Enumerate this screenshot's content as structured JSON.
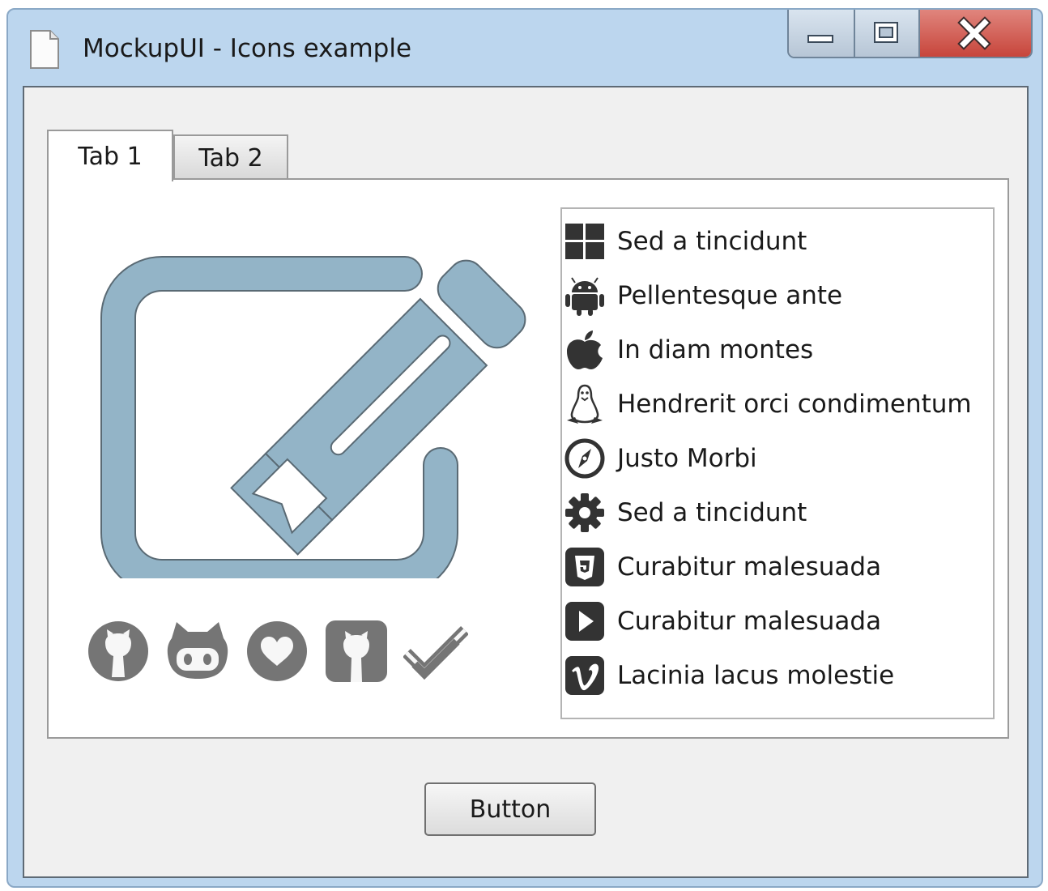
{
  "window": {
    "title": "MockupUI - Icons example",
    "title_bar_color": "#bcd6ee",
    "close_button_color": "#c7453b"
  },
  "tabs": [
    {
      "label": "Tab 1",
      "selected": true
    },
    {
      "label": "Tab 2",
      "selected": false
    }
  ],
  "main_icon": {
    "name": "edit-pencil-icon",
    "color": "#93b4c7"
  },
  "social_icons": [
    {
      "name": "github-icon"
    },
    {
      "name": "github-alt-icon"
    },
    {
      "name": "heart-circle-icon"
    },
    {
      "name": "github-square-icon"
    },
    {
      "name": "check-double-icon"
    }
  ],
  "social_icon_color": "#757575",
  "list": {
    "items": [
      {
        "icon": "windows-icon",
        "label": "Sed a tincidunt"
      },
      {
        "icon": "android-icon",
        "label": "Pellentesque ante"
      },
      {
        "icon": "apple-icon",
        "label": "In diam montes"
      },
      {
        "icon": "linux-icon",
        "label": "Hendrerit orci condimentum"
      },
      {
        "icon": "compass-icon",
        "label": "Justo Morbi"
      },
      {
        "icon": "gear-icon",
        "label": "Sed a tincidunt"
      },
      {
        "icon": "html5-icon",
        "label": "Curabitur malesuada"
      },
      {
        "icon": "play-square-icon",
        "label": "Curabitur malesuada"
      },
      {
        "icon": "vimeo-icon",
        "label": "Lacinia lacus molestie"
      }
    ]
  },
  "button": {
    "label": "Button"
  }
}
